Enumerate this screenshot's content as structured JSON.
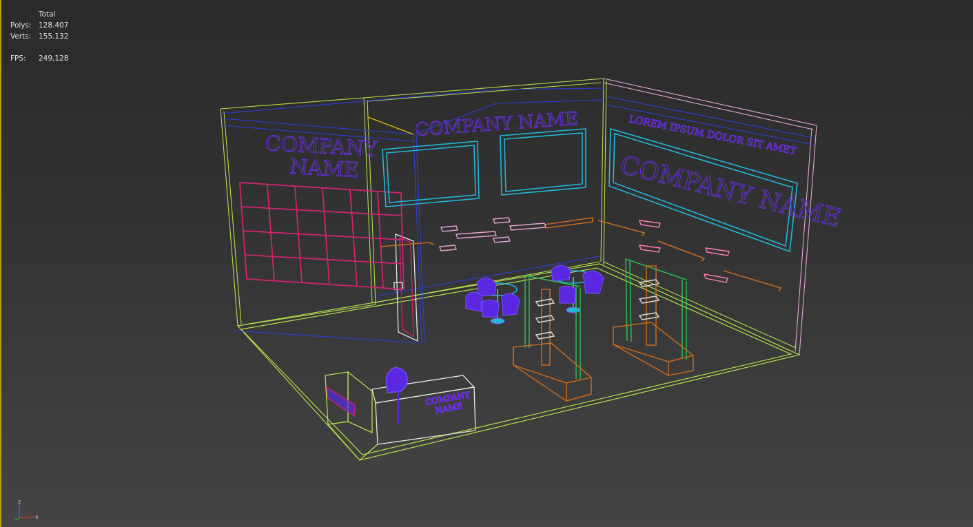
{
  "stats": {
    "header": "Total",
    "polys_label": "Polys:",
    "polys_value": "128.407",
    "verts_label": "Verts:",
    "verts_value": "155.132",
    "fps_label": "FPS:",
    "fps_value": "249,128"
  },
  "scene": {
    "left_wall_text_line1": "COMPANY",
    "left_wall_text_line2": "NAME",
    "back_wall_text": "COMPANY NAME",
    "right_wall_text_top": "LOREM IPSUM DOLOR SIT AMET",
    "right_wall_text_main": "COMPANY NAME",
    "counter_text_line1": "COMPANY",
    "counter_text_line2": "NAME"
  },
  "gizmo": {
    "z_label": "z",
    "x_label": "x"
  },
  "colors": {
    "viewport_border": "#b8a100",
    "wireframe_floor": "#b6e04a",
    "wireframe_right_wall": "#e6a6d6",
    "wireframe_blue": "#2d3fd6",
    "text_purple": "#6a2fe0",
    "screen_cyan": "#22b7d9",
    "grid_magenta": "#d0246f",
    "shelf_orange": "#c86a1c",
    "stand_green": "#2bbf52",
    "furniture_violet": "#5a28e0"
  }
}
